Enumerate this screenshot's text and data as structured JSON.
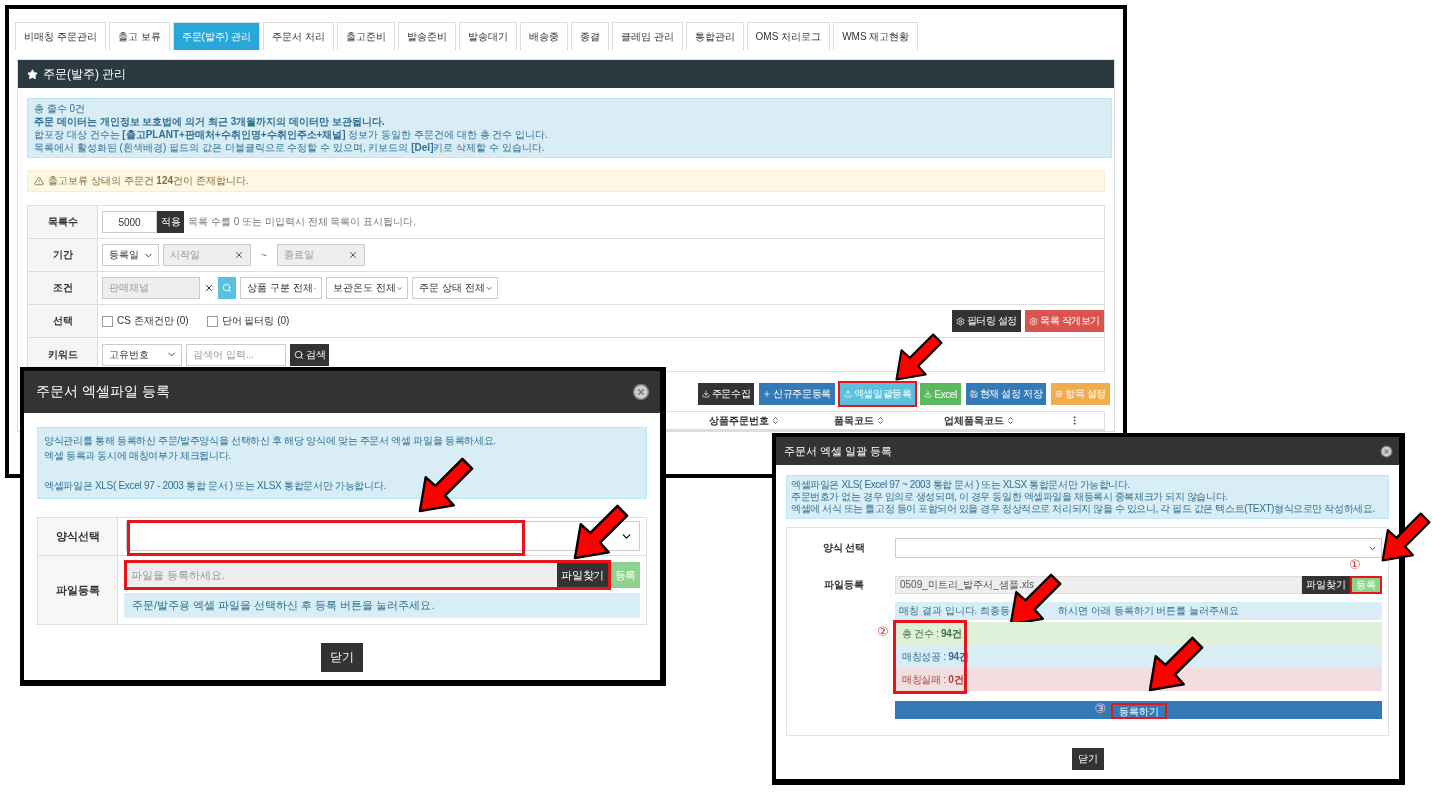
{
  "main_window": {
    "tabs": [
      {
        "label": "비매칭 주문관리",
        "selected": false
      },
      {
        "label": "출고 보류",
        "selected": false
      },
      {
        "label": "주문(발주) 관리",
        "selected": true
      },
      {
        "label": "주문서 처리",
        "selected": false
      },
      {
        "label": "출고준비",
        "selected": false
      },
      {
        "label": "발송준비",
        "selected": false
      },
      {
        "label": "발송대기",
        "selected": false
      },
      {
        "label": "배송중",
        "selected": false
      },
      {
        "label": "종결",
        "selected": false
      },
      {
        "label": "클레임 관리",
        "selected": false
      },
      {
        "label": "통합관리",
        "selected": false
      },
      {
        "label": "OMS 처리로그",
        "selected": false
      },
      {
        "label": "WMS 재고현황",
        "selected": false
      }
    ],
    "panel_title": "주문(발주) 관리",
    "notice": [
      {
        "text": "총 줄수 0건",
        "emphasis": false
      },
      {
        "text": "주문 데이터는 개인정보 보호법에 의거 최근 3개월까지의 데이터만 보관됩니다.",
        "emphasis": true
      },
      {
        "text": "합포장 대상 건수는 **[출고PLANT+판매처+수취인명+수취인주소+채널]** 정보가 동일한 주문건에 대한 총 건수 입니다.",
        "emphasis": false
      },
      {
        "text": "목록에서 활성화된 (흰색배경) 필드의 값은 더블클릭으로 수정할 수 있으며, 키보드의 **[Del]**키로 삭제할 수 있습니다.",
        "emphasis": false
      }
    ],
    "warning": "출고보류 상태의 주문건 **124**건이 존재합니다.",
    "filters": {
      "list_count": {
        "label": "목록수",
        "value": "5000",
        "apply": "적용",
        "hint": "목록 수를 0 또는 미입력시 전체 목록이 표시됩니다."
      },
      "period": {
        "label": "기간",
        "type_select": "등록일",
        "start_placeholder": "시작일",
        "separator": "~",
        "end_placeholder": "종료일"
      },
      "condition": {
        "label": "조건",
        "channel_placeholder": "판매채널",
        "selects": [
          "상품 구분 전체",
          "보관온도 전체",
          "주문 상태 전체"
        ]
      },
      "selection": {
        "label": "선택",
        "checkboxes": [
          {
            "label": "CS 존재건만 (0)",
            "checked": false
          },
          {
            "label": "단어 필터링 (0)",
            "checked": false
          }
        ],
        "buttons": [
          {
            "label": "필터링 설정",
            "kind": "dark"
          },
          {
            "label": "목록 작게보기",
            "kind": "danger"
          }
        ]
      },
      "keyword": {
        "label": "키워드",
        "type_select": "고유번호",
        "placeholder": "검색어 입력...",
        "search": "검색"
      }
    },
    "toolbar": [
      {
        "label": "주문수집",
        "kind": "dark",
        "highlighted": false
      },
      {
        "label": "신규주문등록",
        "kind": "primary",
        "highlighted": false
      },
      {
        "label": "엑셀일괄등록",
        "kind": "info",
        "highlighted": true
      },
      {
        "label": "Excel",
        "kind": "success",
        "highlighted": false
      },
      {
        "label": "현재 설정 저장",
        "kind": "primary",
        "highlighted": false
      },
      {
        "label": "항목 설정",
        "kind": "warning",
        "highlighted": false
      }
    ],
    "table_columns": [
      "상품주문번호",
      "품목코드",
      "업체품목코드"
    ]
  },
  "excel_upload_dialog": {
    "title": "주문서 엑셀파일 등록",
    "notice": [
      [
        "양식관리를 통해 등록하신 주문/발주양식을 선택하신 후 해당 양식에 맞는 주문서 엑셀 파일을 등록하세요.",
        "엑셀 등록과 동시에 매칭여부가 체크됩니다."
      ],
      [
        "엑셀파일은 XLS( Excel 97 - 2003 통합 문서 ) 또는 XLSX 통합문서만 가능합니다."
      ]
    ],
    "template_row": {
      "label": "양식선택",
      "highlighted": true
    },
    "file_row": {
      "label": "파일등록",
      "placeholder": "파일을 등록하세요.",
      "browse": "파일찾기",
      "register": "등록",
      "help": "주문/발주용 엑셀 파일을 선택하신 후 등록 버튼을 눌러주세요.",
      "highlighted": true
    },
    "close": "닫기"
  },
  "bulk_upload_dialog": {
    "title": "주문서 엑셀 일괄 등록",
    "notice": [
      "엑셀파일은 XLS( Excel 97 ~ 2003 통합 문서 ) 또는 XLSX 통합문서만 가능합니다.",
      "주문번호가 없는 경우 임의로 생성되며, 이 경우 동일한 엑셀파일을 재등록시 중복체크가 되지 않습니다.",
      "엑셀에 서식 또는 틀고정 등이 포함되어 있을 경우 정상적으로 처리되지 않을 수 있으니, 각 필드 값은 텍스트(TEXT)형식으로만 작성하세요."
    ],
    "template_label": "양식 선택",
    "file_label": "파일등록",
    "file_value": "0509_미트리_발주서_샘플.xls",
    "browse": "파일찾기",
    "register": {
      "label": "등록",
      "highlighted": true,
      "marker": "①"
    },
    "match_message": [
      "매칭 결과 입니다. 최종등",
      "하시면 아래 등록하기 버튼를 눌러주세요"
    ],
    "results": {
      "highlighted": true,
      "marker": "②",
      "rows": [
        {
          "text": "총 건수 : **94건**",
          "kind": "total"
        },
        {
          "text": "매칭성공 : **94건**",
          "kind": "success"
        },
        {
          "text": "매칭실패 : **0건**",
          "kind": "fail"
        }
      ]
    },
    "submit": {
      "label": "등록하기",
      "highlighted": true,
      "marker": "③"
    },
    "close": "닫기"
  }
}
